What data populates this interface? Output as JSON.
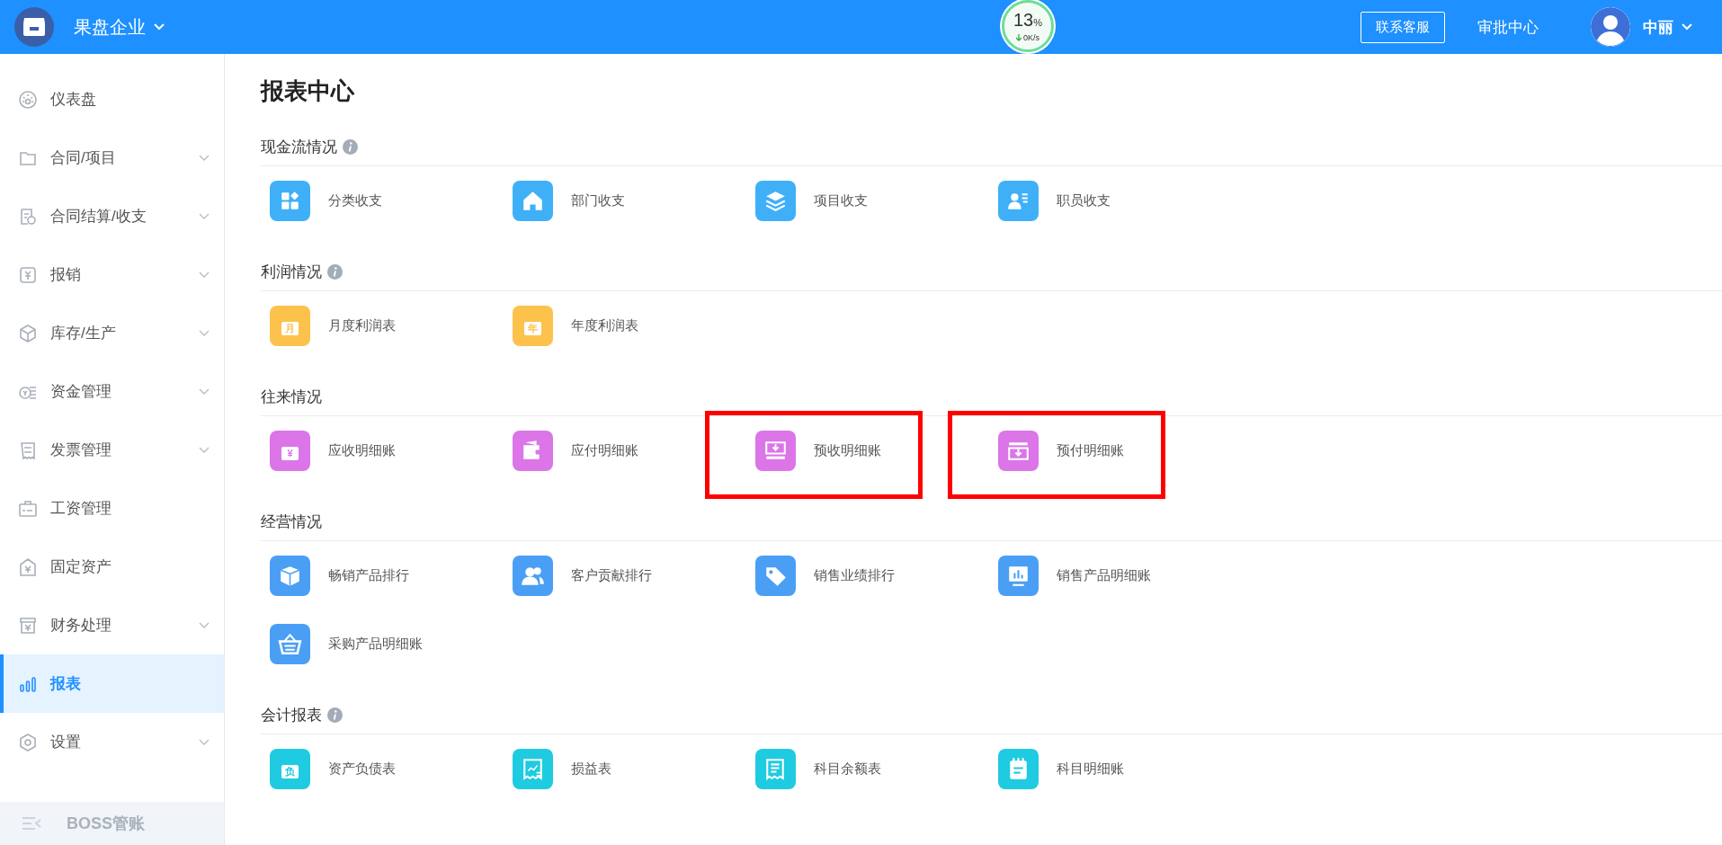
{
  "header": {
    "company": "果盘企业",
    "gauge": {
      "percent": "13",
      "unit": "%",
      "speed": "0K/s"
    },
    "contact_button": "联系客服",
    "approval": "审批中心",
    "user": "中丽"
  },
  "sidebar": {
    "items": [
      {
        "label": "仪表盘",
        "kind": "link",
        "selected": false
      },
      {
        "label": "合同/项目",
        "kind": "group",
        "selected": false
      },
      {
        "label": "合同结算/收支",
        "kind": "group",
        "selected": false
      },
      {
        "label": "报销",
        "kind": "group",
        "selected": false
      },
      {
        "label": "库存/生产",
        "kind": "group",
        "selected": false
      },
      {
        "label": "资金管理",
        "kind": "group",
        "selected": false
      },
      {
        "label": "发票管理",
        "kind": "group",
        "selected": false
      },
      {
        "label": "工资管理",
        "kind": "link",
        "selected": false
      },
      {
        "label": "固定资产",
        "kind": "link",
        "selected": false
      },
      {
        "label": "财务处理",
        "kind": "group",
        "selected": false
      },
      {
        "label": "报表",
        "kind": "link",
        "selected": true
      },
      {
        "label": "设置",
        "kind": "group",
        "selected": false
      }
    ],
    "footer": "BOSS管账"
  },
  "page_title": "报表中心",
  "sections": [
    {
      "title": "现金流情况",
      "info": true,
      "color": "#3fb0f8",
      "items": [
        {
          "label": "分类收支",
          "highlighted": false
        },
        {
          "label": "部门收支",
          "highlighted": false
        },
        {
          "label": "项目收支",
          "highlighted": false
        },
        {
          "label": "职员收支",
          "highlighted": false
        }
      ]
    },
    {
      "title": "利润情况",
      "info": true,
      "color": "#fcc24c",
      "items": [
        {
          "label": "月度利润表",
          "glyph": "月",
          "highlighted": false
        },
        {
          "label": "年度利润表",
          "glyph": "年",
          "highlighted": false
        }
      ]
    },
    {
      "title": "往来情况",
      "info": false,
      "color": "#db75e8",
      "items": [
        {
          "label": "应收明细账",
          "glyph": "¥",
          "highlighted": false
        },
        {
          "label": "应付明细账",
          "highlighted": false
        },
        {
          "label": "预收明细账",
          "highlighted": true
        },
        {
          "label": "预付明细账",
          "highlighted": true
        }
      ]
    },
    {
      "title": "经营情况",
      "info": false,
      "color": "#4a9ff5",
      "items": [
        {
          "label": "畅销产品排行",
          "highlighted": false
        },
        {
          "label": "客户贡献排行",
          "highlighted": false
        },
        {
          "label": "销售业绩排行",
          "highlighted": false
        },
        {
          "label": "销售产品明细账",
          "highlighted": false
        },
        {
          "label": "采购产品明细账",
          "highlighted": false
        }
      ]
    },
    {
      "title": "会计报表",
      "info": true,
      "color": "#1fcbe0",
      "items": [
        {
          "label": "资产负债表",
          "glyph": "负",
          "highlighted": false
        },
        {
          "label": "损益表",
          "highlighted": false
        },
        {
          "label": "科目余额表",
          "highlighted": false
        },
        {
          "label": "科目明细账",
          "highlighted": false
        }
      ]
    }
  ]
}
